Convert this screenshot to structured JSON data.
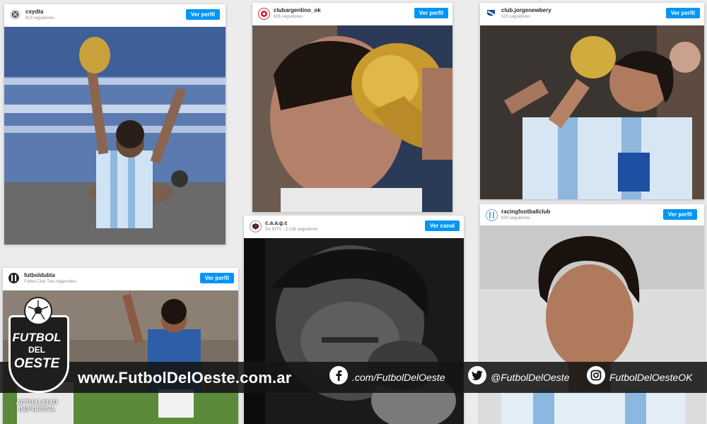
{
  "posts": [
    {
      "username": "csydta",
      "meta": "923 seguidores",
      "button": "Ver perfil"
    },
    {
      "username": "clubargentino_ok",
      "meta": "605 seguidores",
      "button": "Ver perfil"
    },
    {
      "username": "club.jorgenewbery",
      "meta": "523 seguidores",
      "button": "Ver perfil"
    },
    {
      "username": "futboldubta",
      "meta": "Futbol Club Tres Algarrobos",
      "button": "Ver perfil"
    },
    {
      "username": "c.a.a.g.c",
      "meta": "De IGTV · 2.138 seguidores",
      "button": "Ver canal"
    },
    {
      "username": "racingfootballclub",
      "meta": "620 seguidores",
      "button": "Ver perfil"
    }
  ],
  "banner": {
    "website": "www.FutbolDelOeste.com.ar",
    "facebook": ".com/FutbolDelOeste",
    "twitter": "@FutbolDelOeste",
    "instagram": "FutbolDelOesteOK"
  },
  "logo": {
    "line1": "FUTBOL",
    "line2": "DEL",
    "line3": "OESTE",
    "sub1": "ACTUALIDAD",
    "sub2": "DEPORTIVA"
  },
  "icons": [
    "facebook-icon",
    "twitter-icon",
    "instagram-icon"
  ],
  "colors": {
    "accent": "#0095f6",
    "banner": "#141414"
  }
}
